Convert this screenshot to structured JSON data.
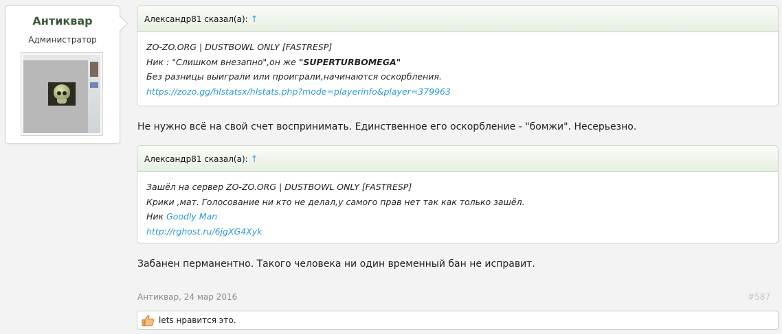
{
  "user": {
    "name": "Антиквар",
    "title": "Администратор"
  },
  "quotes": [
    {
      "header": "Александр81 сказал(а):",
      "arrow": "↑",
      "lines": {
        "l1": "ZO-ZO.ORG | DUSTBOWL ONLY [FASTRESP]",
        "l2_pre": "Ник : \"Слишком внезапно\",он же ",
        "l2_bold": "\"SUPERTURBOMEGA\"",
        "l3": "Без разницы выиграли или проиграли,начинаются оскорбления.",
        "l4_link": "https://zozo.gg/hlstatsx/hlstats.php?mode=playerinfo&player=379963"
      }
    },
    {
      "header": "Александр81 сказал(а):",
      "arrow": "↑",
      "lines": {
        "l1": "Зашёл на сервер ZO-ZO.ORG | DUSTBOWL ONLY [FASTRESP]",
        "l2": "Крики ,мат. Голосование ни кто не делал,у самого прав нет так как только зашёл.",
        "l3_pre": "Ник ",
        "l3_link": "Goodly Man",
        "l4_link": "http://rghost.ru/6jgXG4Xyk"
      }
    }
  ],
  "replies": {
    "r1": "Не нужно всё на свой счет воспринимать. Единственное его оскорбление - \"бомжи\". Несерьезно.",
    "r2": "Забанен перманентно. Такого человека ни один временный бан не исправит."
  },
  "meta": {
    "author_date": "Антиквар, 24 мар 2016",
    "post_number": "#587"
  },
  "likes": {
    "icon": "thumbs-up-icon",
    "text": "lets нравится это."
  }
}
